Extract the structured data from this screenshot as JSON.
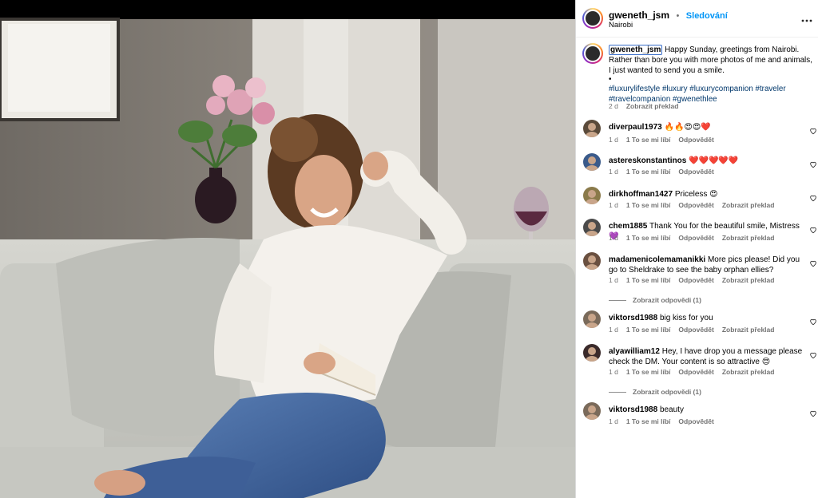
{
  "post": {
    "username": "gweneth_jsm",
    "follow_label": "Sledování",
    "location": "Nairobi",
    "more_icon": "more-dots-icon",
    "caption_user": "gweneth_jsm",
    "caption_text": "Happy Sunday, greetings from Nairobi. Rather than bore you with more photos of me and animals, I just wanted to send you a smile.",
    "caption_dot": "•",
    "hashtags": "#luxurylifestyle #luxury #luxurycompanion #traveler #travelcompanion #gwenethlee",
    "caption_age": "2 d",
    "caption_translate": "Zobrazit překlad"
  },
  "comments": [
    {
      "user": "diverpaul1973",
      "text": "🔥🔥😍😍❤️",
      "age": "1 d",
      "likes": "1 To se mi líbí",
      "action": "Odpovědět",
      "translate": "",
      "avatar_color": "#5a4a3a"
    },
    {
      "user": "astereskonstantinos",
      "text": "❤️❤️❤️❤️❤️",
      "age": "1 d",
      "likes": "1 To se mi líbí",
      "action": "Odpovědět",
      "translate": "",
      "avatar_color": "#3a5a8a"
    },
    {
      "user": "dirkhoffman1427",
      "text": "Priceless 😍",
      "age": "1 d",
      "likes": "1 To se mi líbí",
      "action": "Odpovědět",
      "translate": "Zobrazit překlad",
      "avatar_color": "#8a7a4a"
    },
    {
      "user": "chem1885",
      "text": "Thank You for the beautiful smile, Mistress 💜",
      "age": "1 d",
      "likes": "1 To se mi líbí",
      "action": "Odpovědět",
      "translate": "Zobrazit překlad",
      "avatar_color": "#4a4a4a"
    },
    {
      "user": "madamenicolemamanikki",
      "text": "More pics please! Did you go to Sheldrake to see the baby orphan ellies?",
      "age": "1 d",
      "likes": "1 To se mi líbí",
      "action": "Odpovědět",
      "translate": "Zobrazit překlad",
      "avatar_color": "#6a5040",
      "replies": "Zobrazit odpovědi (1)"
    },
    {
      "user": "viktorsd1988",
      "text": "big kiss for you",
      "age": "1 d",
      "likes": "1 To se mi líbí",
      "action": "Odpovědět",
      "translate": "Zobrazit překlad",
      "avatar_color": "#7a6a5a"
    },
    {
      "user": "alyawilliam12",
      "text": "Hey, I have drop you a message please check the DM. Your content is so attractive 😍",
      "age": "1 d",
      "likes": "1 To se mi líbí",
      "action": "Odpovědět",
      "translate": "Zobrazit překlad",
      "avatar_color": "#3a2a2a",
      "replies": "Zobrazit odpovědi (1)"
    },
    {
      "user": "viktorsd1988",
      "text": "beauty",
      "age": "1 d",
      "likes": "1 To se mi líbí",
      "action": "Odpovědět",
      "translate": "",
      "avatar_color": "#7a6a5a"
    }
  ]
}
